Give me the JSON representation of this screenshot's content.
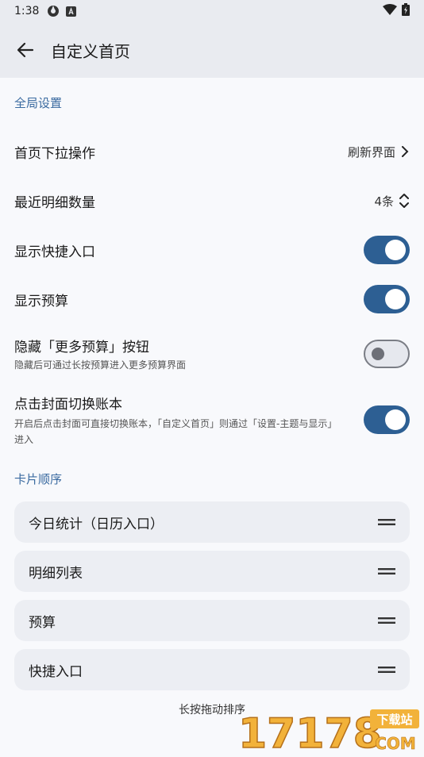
{
  "status_bar": {
    "time": "1:38"
  },
  "app_bar": {
    "title": "自定义首页"
  },
  "global_section": {
    "title": "全局设置",
    "pull_down": {
      "label": "首页下拉操作",
      "value": "刷新界面"
    },
    "recent_count": {
      "label": "最近明细数量",
      "value": "4条"
    },
    "show_shortcuts": {
      "label": "显示快捷入口",
      "enabled": true
    },
    "show_budget": {
      "label": "显示预算",
      "enabled": true
    },
    "hide_more_budget": {
      "label": "隐藏「更多预算」按钮",
      "sub": "隐藏后可通过长按预算进入更多预算界面",
      "enabled": false
    },
    "cover_switch": {
      "label": "点击封面切换账本",
      "sub": "开启后点击封面可直接切换账本，「自定义首页」则通过「设置-主题与显示」进入",
      "enabled": true
    }
  },
  "card_section": {
    "title": "卡片顺序",
    "cards": [
      {
        "label": "今日统计（日历入口）"
      },
      {
        "label": "明细列表"
      },
      {
        "label": "预算"
      },
      {
        "label": "快捷入口"
      }
    ],
    "hint": "长按拖动排序"
  },
  "watermark": {
    "text": "17178",
    "badge": "下载站",
    "domain": "COM"
  },
  "colors": {
    "accent": "#2d5f93",
    "section": "#3a6aa0"
  }
}
